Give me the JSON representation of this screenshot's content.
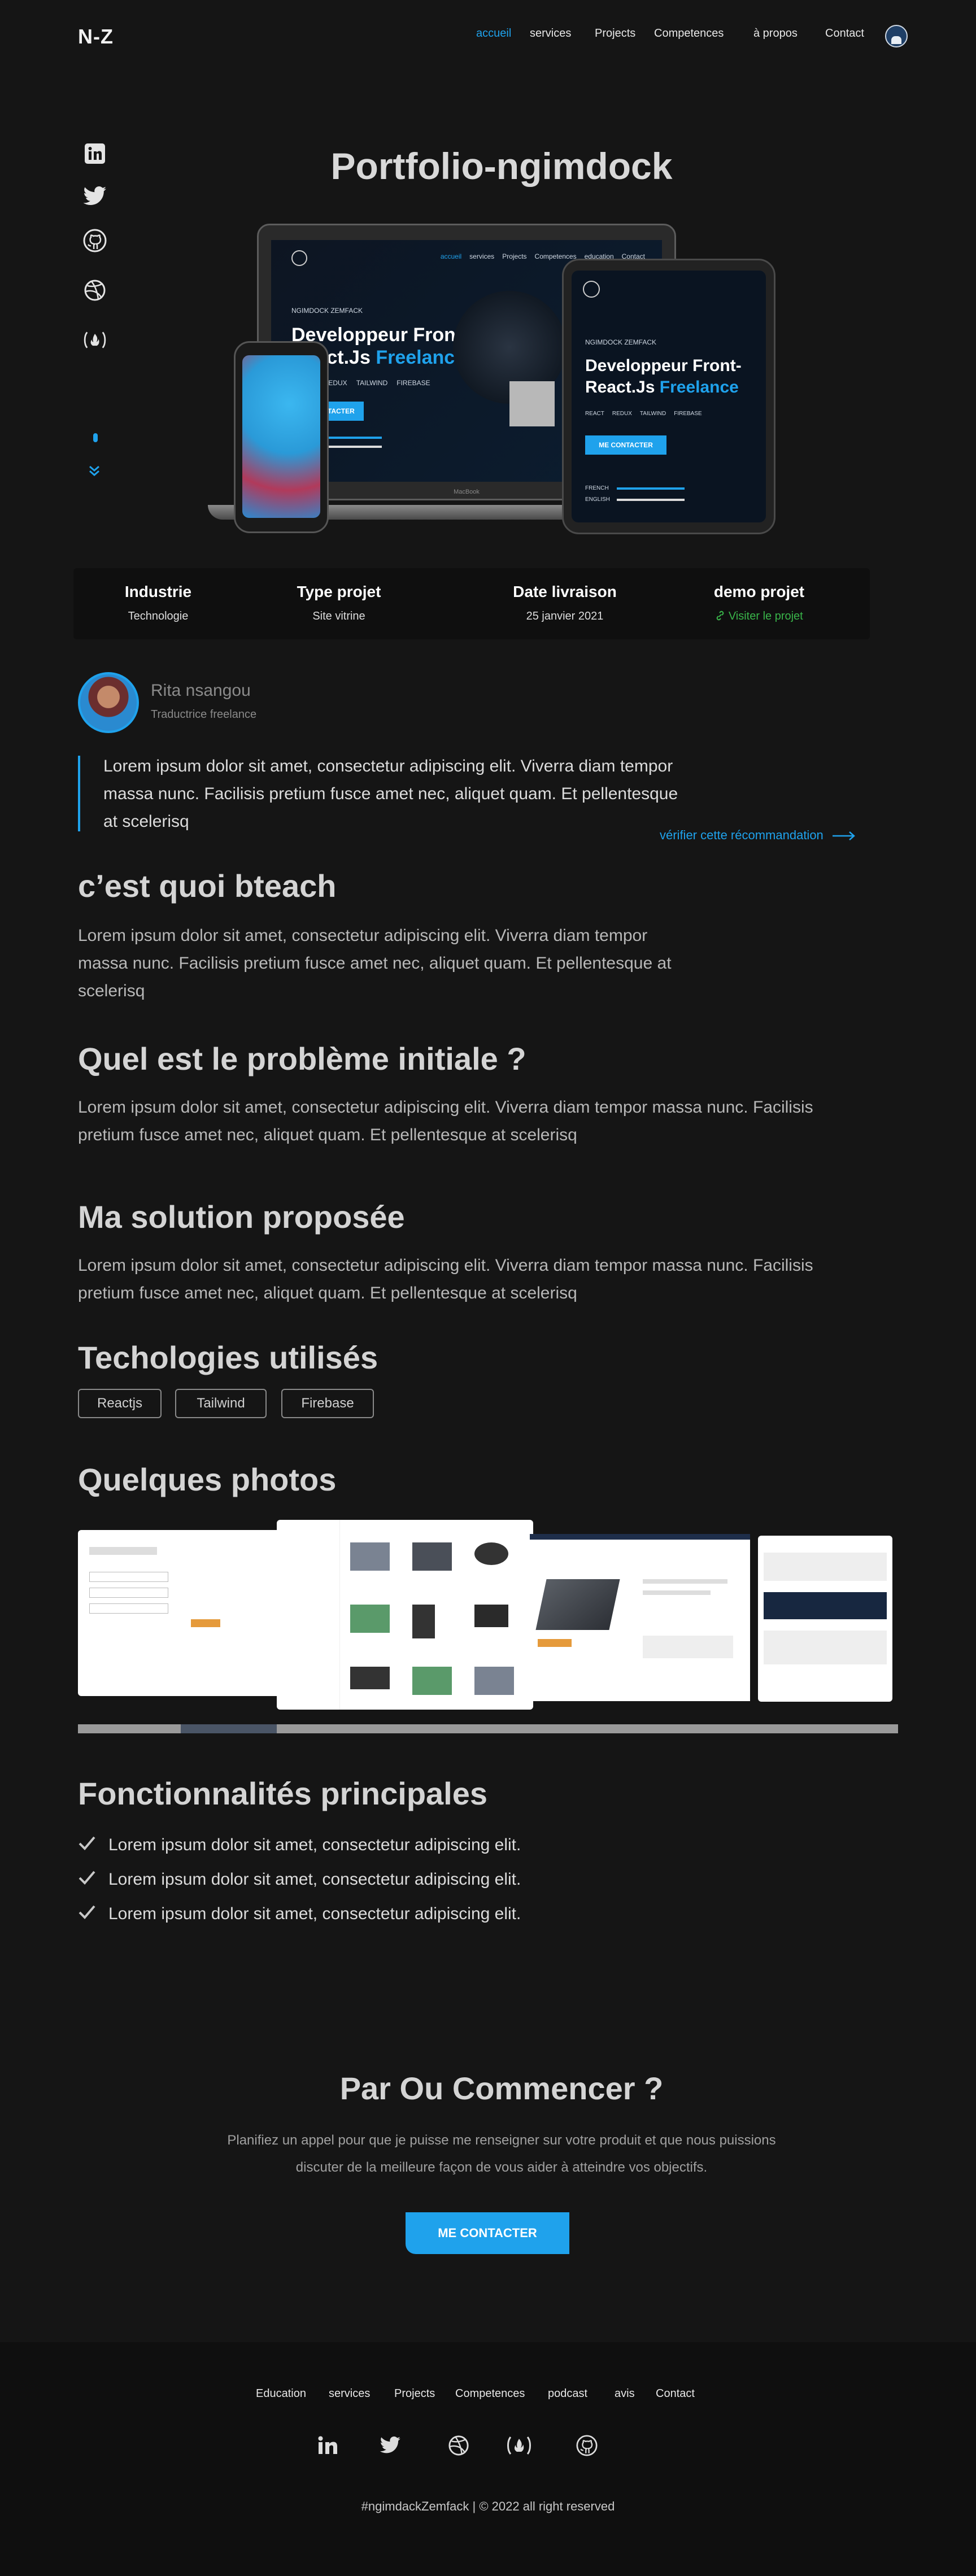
{
  "header": {
    "logo": "N-Z",
    "nav": [
      "accueil",
      "services",
      "Projects",
      "Competences",
      "à propos",
      "Contact"
    ]
  },
  "page": {
    "title": "Portfolio-ngimdock"
  },
  "mockup": {
    "kicker": "NGIMDOCK ZEMFACK",
    "headline_1": "Developpeur Front-End",
    "headline_2": "React.Js",
    "headline_accent": "Freelance",
    "tablet_headline_1": "Developpeur Front-",
    "tablet_headline_2": "React.Js",
    "button": "ME CONTACTER",
    "laptop_nav": [
      "accueil",
      "services",
      "Projects",
      "Competences",
      "education",
      "Contact"
    ],
    "techs": [
      "REACT",
      "REDUX",
      "TAILWIND",
      "FIREBASE"
    ],
    "langs": [
      "FRENCH",
      "ENGLISH"
    ],
    "brand": "MacBook"
  },
  "info": [
    {
      "label": "Industrie",
      "value": "Technologie"
    },
    {
      "label": "Type projet",
      "value": "Site vitrine"
    },
    {
      "label": "Date livraison",
      "value": "25 janvier 2021"
    },
    {
      "label": "demo projet",
      "value": "Visiter le projet"
    }
  ],
  "testimonial": {
    "name": "Rita nsangou",
    "role": "Traductrice freelance",
    "quote": "Lorem ipsum dolor sit amet, consectetur adipiscing elit. Viverra diam tempor massa nunc. Facilisis pretium fusce amet nec, aliquet quam. Et pellentesque at scelerisq",
    "verify": "vérifier  cette récommandation"
  },
  "sections": {
    "what_title": "c’est quoi bteach",
    "what_text": "Lorem ipsum dolor sit amet, consectetur adipiscing elit. Viverra diam tempor massa nunc. Facilisis pretium fusce amet nec, aliquet quam. Et pellentesque at scelerisq",
    "problem_title": "Quel est le problème initiale ?",
    "problem_text": "Lorem ipsum dolor sit amet, consectetur adipiscing elit. Viverra diam tempor massa nunc. Facilisis pretium fusce amet nec, aliquet quam. Et pellentesque at scelerisq",
    "solution_title": "Ma solution proposée",
    "solution_text": "Lorem ipsum dolor sit amet, consectetur adipiscing elit. Viverra diam tempor massa nunc. Facilisis pretium fusce amet nec, aliquet quam. Et pellentesque at scelerisq",
    "tech_title": "Techologies  utilisés",
    "tech_tags": [
      "Reactjs",
      "Tailwind",
      "Firebase"
    ],
    "photos_title": "Quelques photos",
    "features_title": "Fonctionnalités principales",
    "features": [
      "Lorem ipsum dolor sit amet, consectetur adipiscing elit.",
      "Lorem ipsum dolor sit amet, consectetur adipiscing elit.",
      "Lorem ipsum dolor sit amet, consectetur adipiscing elit."
    ]
  },
  "cta": {
    "title": "Par Ou Commencer ?",
    "text": "Planifiez un appel pour que je puisse me renseigner sur votre produit et que nous puissions discuter de la meilleure façon de vous aider à atteindre vos objectifs.",
    "button": "ME CONTACTER"
  },
  "footer": {
    "nav": [
      "Education",
      "services",
      "Projects",
      "Competences",
      "podcast",
      "avis",
      "Contact"
    ],
    "copyright": "#ngimdackZemfack | © 2022 all right reserved"
  },
  "colors": {
    "accent": "#1fa2ec",
    "background": "#151515",
    "link_green": "#39b54a"
  },
  "icons": [
    "linkedin-icon",
    "twitter-icon",
    "github-icon",
    "dribbble-icon",
    "freecodecamp-icon",
    "chevron-down-icon",
    "check-icon",
    "link-icon",
    "arrow-right-icon"
  ]
}
